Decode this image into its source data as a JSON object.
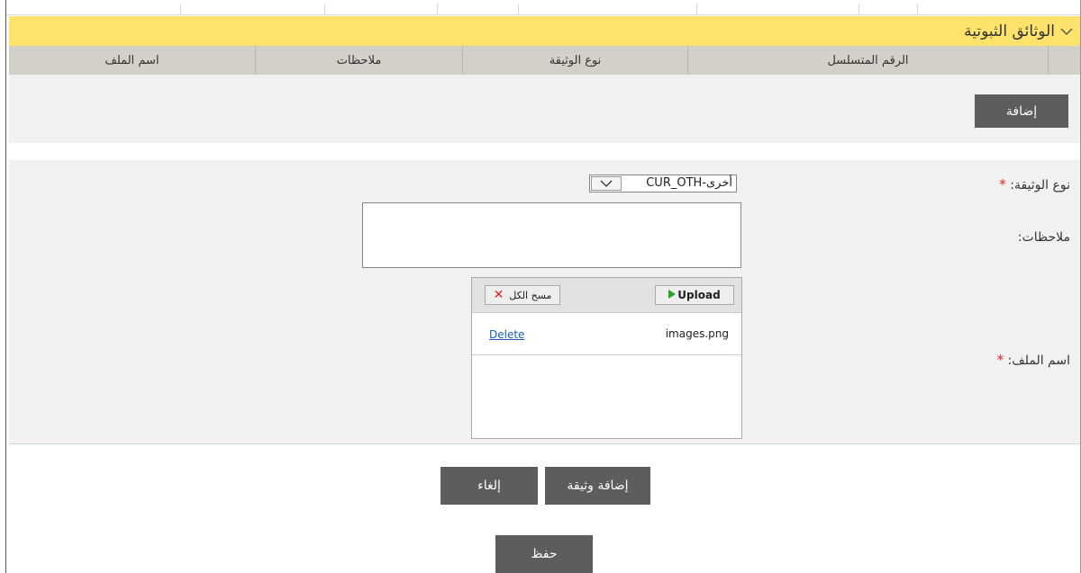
{
  "section": {
    "title": "الوثائق الثبوتية",
    "chevron_icon": "chevron-down-icon"
  },
  "grid": {
    "columns": [
      "اسم الملف",
      "ملاحظات",
      "نوع الوثيقة",
      "الرقم المتسلسل"
    ],
    "add_button": "إضافة"
  },
  "form": {
    "doc_type_label": "نوع الوثيقة:",
    "doc_type_value": "أخرى-CUR_OTH",
    "notes_label": "ملاحظات:",
    "notes_value": "",
    "file_label": "اسم الملف:",
    "required_mark": "*"
  },
  "uploader": {
    "upload_label": "Upload",
    "clear_all_label": "مسح الكل",
    "files": [
      {
        "name": "images.png",
        "delete_label": "Delete"
      }
    ]
  },
  "actions": {
    "add_document": "إضافة وثيقة",
    "cancel": "إلغاء",
    "save": "حفظ"
  },
  "colors": {
    "header_bg": "#fde36b",
    "grid_header_bg": "#d3d0c8",
    "button_bg": "#5d5d5d",
    "required": "#e02020"
  }
}
